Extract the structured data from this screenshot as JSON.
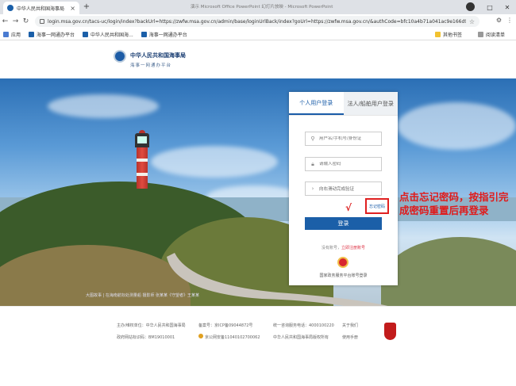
{
  "browser": {
    "tab_title": "中华人民共和国海事局",
    "window_title": "演示 Microsoft Office PowerPoint 幻灯片放映 - Microsoft PowerPoint",
    "url": "login.msa.gov.cn/tacs-uc/login/index?backUrl=https://zwfw.msa.gov.cn/admin/base/loginUrlBack/index?goUrl=https://zwfw.msa.gov.cn/&authCode=bfc10a4b71a041ac9e166d97ae42702d1627...",
    "bookmarks": [
      {
        "label": "应用",
        "icon": "apps-icon"
      },
      {
        "label": "海事一网通办平台",
        "icon": "site-icon"
      },
      {
        "label": "中华人民共和国海...",
        "icon": "site-icon"
      },
      {
        "label": "海事一网通办平台",
        "icon": "site-icon"
      }
    ],
    "bookmarks_right": [
      "其他书签",
      "阅读清单"
    ]
  },
  "site": {
    "title": "中华人民共和国海事局",
    "subtitle": "海事一网通办平台"
  },
  "banner": {
    "caption": "大图故事 | 在海南航标处测量船 摄影师 张某某《守望者》王某某"
  },
  "login": {
    "tab_personal": "个人用户登录",
    "tab_corporate": "法人/船舶用户登录",
    "username_placeholder": "用户名/手机号/身份证",
    "password_placeholder": "请输入密码",
    "captcha_text": "向右滑动完成验证",
    "forgot_password": "忘记密码",
    "login_button": "登录",
    "register_prompt": "没有账号，",
    "register_link": "立即注册账号",
    "gov_badge_text": "国家政务服务平台账号登录"
  },
  "annotation": {
    "text": "点击忘记密码，按指引完成密码重置后再登录",
    "color": "#e01a1a"
  },
  "footer": {
    "sponsor": "主办/维权单位：中华人民共和国海事局",
    "icp": "备案号：京ICP备09044872号",
    "hotline": "统一咨询服务电话：4000100220",
    "about": "关于我们",
    "gov_code": "政府网站标识码：BM19010001",
    "police": "京公网安备11040102700062",
    "copyright": "中华人民共和国海事局版权所有",
    "help": "使用手册"
  },
  "colors": {
    "brand_blue": "#1b5fa8",
    "highlight_red": "#e02020"
  }
}
